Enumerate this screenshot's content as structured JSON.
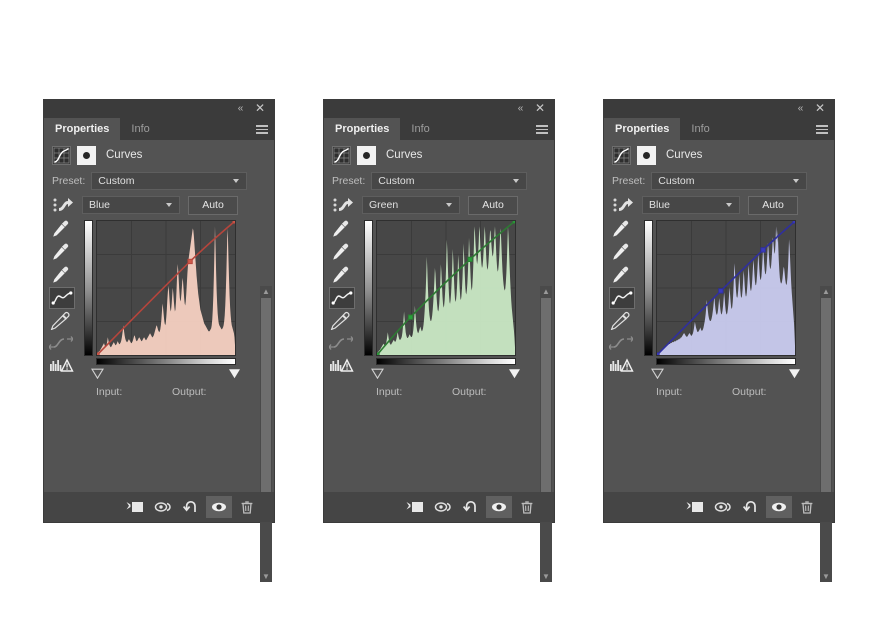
{
  "app": {
    "background_color": "#ffffff",
    "panel_bg": "#535353",
    "titlebar_bg": "#3b3b3b"
  },
  "panels": [
    {
      "id": "panel-red",
      "titlebar": {
        "collapse_icon": "double-chevron-left-icon",
        "close_icon": "close-icon"
      },
      "tabs": [
        {
          "label": "Properties",
          "active": true
        },
        {
          "label": "Info",
          "active": false
        }
      ],
      "menu_icon": "hamburger-menu-icon",
      "header": {
        "adjustment_icon": "curves-adjustment-icon",
        "mask_icon": "layer-mask-icon",
        "title": "Curves"
      },
      "preset": {
        "label": "Preset:",
        "value": "Custom"
      },
      "channel": {
        "icon": "on-image-adjust-icon",
        "value": "Blue",
        "auto_label": "Auto"
      },
      "tools": [
        "white-point-eyedropper-icon",
        "gray-point-eyedropper-icon",
        "black-point-eyedropper-icon",
        "curve-point-tool-icon",
        "pencil-tool-icon",
        "smooth-curve-icon",
        "histogram-warning-icon"
      ],
      "selected_tool": "curve-point-tool-icon",
      "labels": {
        "input": "Input:",
        "output": "Output:"
      },
      "bottom_icons": [
        "clip-to-layer-icon",
        "view-previous-state-icon",
        "reset-adjustment-icon",
        "toggle-visibility-icon",
        "delete-adjustment-icon"
      ],
      "selected_bottom_icon": "toggle-visibility-icon",
      "curve_color": "#b5453c",
      "fill_color": "rgba(252,213,198,0.92)",
      "point_color": "#cf5a4a"
    },
    {
      "id": "panel-green",
      "titlebar": {
        "collapse_icon": "double-chevron-left-icon",
        "close_icon": "close-icon"
      },
      "tabs": [
        {
          "label": "Properties",
          "active": true
        },
        {
          "label": "Info",
          "active": false
        }
      ],
      "menu_icon": "hamburger-menu-icon",
      "header": {
        "adjustment_icon": "curves-adjustment-icon",
        "mask_icon": "layer-mask-icon",
        "title": "Curves"
      },
      "preset": {
        "label": "Preset:",
        "value": "Custom"
      },
      "channel": {
        "icon": "on-image-adjust-icon",
        "value": "Green",
        "auto_label": "Auto"
      },
      "tools": [
        "white-point-eyedropper-icon",
        "gray-point-eyedropper-icon",
        "black-point-eyedropper-icon",
        "curve-point-tool-icon",
        "pencil-tool-icon",
        "smooth-curve-icon",
        "histogram-warning-icon"
      ],
      "selected_tool": "curve-point-tool-icon",
      "labels": {
        "input": "Input:",
        "output": "Output:"
      },
      "bottom_icons": [
        "clip-to-layer-icon",
        "view-previous-state-icon",
        "reset-adjustment-icon",
        "toggle-visibility-icon",
        "delete-adjustment-icon"
      ],
      "selected_bottom_icon": "toggle-visibility-icon",
      "curve_color": "#2d7a33",
      "fill_color": "rgba(206,238,201,0.92)",
      "point_color": "#28a03a"
    },
    {
      "id": "panel-blue",
      "titlebar": {
        "collapse_icon": "double-chevron-left-icon",
        "close_icon": "close-icon"
      },
      "tabs": [
        {
          "label": "Properties",
          "active": true
        },
        {
          "label": "Info",
          "active": false
        }
      ],
      "menu_icon": "hamburger-menu-icon",
      "header": {
        "adjustment_icon": "curves-adjustment-icon",
        "mask_icon": "layer-mask-icon",
        "title": "Curves"
      },
      "preset": {
        "label": "Preset:",
        "value": "Custom"
      },
      "channel": {
        "icon": "on-image-adjust-icon",
        "value": "Blue",
        "auto_label": "Auto"
      },
      "tools": [
        "white-point-eyedropper-icon",
        "gray-point-eyedropper-icon",
        "black-point-eyedropper-icon",
        "curve-point-tool-icon",
        "pencil-tool-icon",
        "smooth-curve-icon",
        "histogram-warning-icon"
      ],
      "selected_tool": "curve-point-tool-icon",
      "labels": {
        "input": "Input:",
        "output": "Output:"
      },
      "bottom_icons": [
        "clip-to-layer-icon",
        "view-previous-state-icon",
        "reset-adjustment-icon",
        "toggle-visibility-icon",
        "delete-adjustment-icon"
      ],
      "selected_bottom_icon": "toggle-visibility-icon",
      "curve_color": "#2f2f9e",
      "fill_color": "rgba(206,208,245,0.92)",
      "point_color": "#3a3ac0"
    }
  ],
  "chart_data": [
    {
      "type": "line",
      "title": "Curves — Red channel",
      "xlabel": "Input",
      "ylabel": "Output",
      "xlim": [
        0,
        255
      ],
      "ylim": [
        0,
        255
      ],
      "grid": true,
      "grid_divisions": 4,
      "curve_points": [
        {
          "input": 0,
          "output": 0
        },
        {
          "input": 172,
          "output": 178
        },
        {
          "input": 255,
          "output": 255
        }
      ],
      "histogram": [
        2,
        2,
        3,
        3,
        4,
        4,
        5,
        6,
        7,
        8,
        9,
        10,
        11,
        12,
        10,
        9,
        8,
        9,
        11,
        14,
        18,
        15,
        12,
        10,
        9,
        8,
        8,
        9,
        10,
        11,
        12,
        13,
        12,
        11,
        10,
        10,
        11,
        12,
        14,
        13,
        12,
        11,
        11,
        12,
        13,
        15,
        18,
        22,
        26,
        30,
        24,
        20,
        17,
        15,
        14,
        13,
        13,
        14,
        15,
        16,
        15,
        14,
        13,
        12,
        12,
        13,
        14,
        16,
        18,
        20,
        19,
        17,
        15,
        14,
        14,
        15,
        16,
        17,
        18,
        17,
        16,
        15,
        14,
        14,
        15,
        16,
        17,
        18,
        17,
        16,
        15,
        15,
        16,
        17,
        18,
        19,
        20,
        21,
        22,
        21,
        20,
        19,
        18,
        18,
        19,
        20,
        22,
        24,
        26,
        28,
        30,
        29,
        27,
        25,
        24,
        23,
        24,
        26,
        30,
        36,
        44,
        52,
        48,
        42,
        36,
        32,
        30,
        32,
        38,
        46,
        56,
        64,
        70,
        64,
        56,
        48,
        44,
        46,
        52,
        60,
        68,
        62,
        54,
        48,
        44,
        46,
        54,
        66,
        80,
        92,
        86,
        76,
        66,
        58,
        54,
        56,
        62,
        70,
        78,
        74,
        66,
        58,
        52,
        50,
        54,
        62,
        72,
        82,
        90,
        96,
        100,
        104,
        108,
        112,
        116,
        120,
        124,
        128,
        126,
        120,
        112,
        104,
        96,
        88,
        80,
        74,
        68,
        62,
        58,
        54,
        50,
        46,
        44,
        42,
        40,
        38,
        36,
        34,
        32,
        31,
        30,
        29,
        28,
        27,
        26,
        25,
        24,
        24,
        24,
        25,
        26,
        27,
        30,
        36,
        46,
        60,
        80,
        105,
        130,
        110,
        86,
        66,
        52,
        42,
        36,
        32,
        30,
        29,
        28,
        27,
        26,
        26,
        27,
        28,
        30,
        34,
        40,
        50,
        64,
        82,
        104,
        128,
        118,
        96,
        76,
        60,
        48,
        40,
        34,
        30,
        28,
        26,
        24,
        22,
        18,
        10
      ]
    },
    {
      "type": "line",
      "title": "Curves — Green channel",
      "xlabel": "Input",
      "ylabel": "Output",
      "xlim": [
        0,
        255
      ],
      "ylim": [
        0,
        255
      ],
      "grid": true,
      "grid_divisions": 4,
      "curve_points": [
        {
          "input": 0,
          "output": 0
        },
        {
          "input": 62,
          "output": 72
        },
        {
          "input": 172,
          "output": 182
        },
        {
          "input": 255,
          "output": 255
        }
      ],
      "histogram": [
        2,
        3,
        3,
        4,
        5,
        5,
        6,
        7,
        8,
        9,
        10,
        11,
        12,
        11,
        10,
        10,
        11,
        13,
        16,
        20,
        24,
        20,
        16,
        13,
        12,
        11,
        11,
        12,
        13,
        14,
        15,
        16,
        15,
        14,
        14,
        15,
        17,
        20,
        24,
        22,
        19,
        17,
        16,
        16,
        17,
        18,
        20,
        24,
        30,
        38,
        46,
        38,
        30,
        24,
        21,
        19,
        18,
        18,
        19,
        20,
        22,
        21,
        20,
        19,
        19,
        20,
        22,
        26,
        32,
        40,
        52,
        44,
        36,
        30,
        26,
        24,
        23,
        24,
        26,
        28,
        30,
        28,
        26,
        25,
        26,
        28,
        32,
        38,
        46,
        56,
        68,
        84,
        104,
        90,
        72,
        58,
        48,
        42,
        38,
        36,
        36,
        38,
        42,
        48,
        56,
        66,
        78,
        92,
        86,
        74,
        62,
        54,
        48,
        46,
        48,
        54,
        64,
        78,
        96,
        88,
        74,
        62,
        54,
        50,
        52,
        58,
        68,
        82,
        100,
        122,
        110,
        92,
        76,
        64,
        56,
        54,
        58,
        66,
        78,
        94,
        112,
        100,
        84,
        70,
        60,
        56,
        58,
        64,
        74,
        88,
        106,
        96,
        80,
        68,
        60,
        58,
        62,
        70,
        82,
        98,
        118,
        104,
        88,
        74,
        66,
        64,
        68,
        76,
        88,
        104,
        124,
        112,
        96,
        82,
        72,
        68,
        72,
        82,
        96,
        114,
        136,
        130,
        118,
        108,
        100,
        96,
        100,
        108,
        120,
        136,
        130,
        116,
        104,
        96,
        92,
        94,
        100,
        110,
        124,
        136,
        128,
        114,
        102,
        94,
        90,
        92,
        98,
        108,
        122,
        132,
        130,
        120,
        112,
        106,
        104,
        108,
        116,
        128,
        136,
        126,
        112,
        100,
        92,
        88,
        90,
        96,
        106,
        120,
        134,
        128,
        114,
        100,
        88,
        80,
        74,
        70,
        68,
        70,
        76,
        86,
        100,
        118,
        136,
        126,
        110,
        94,
        80,
        68,
        58,
        50,
        44,
        38,
        32,
        26,
        18,
        8
      ]
    },
    {
      "type": "line",
      "title": "Curves — Blue channel",
      "xlabel": "Input",
      "ylabel": "Output",
      "xlim": [
        0,
        255
      ],
      "ylim": [
        0,
        255
      ],
      "grid": true,
      "grid_divisions": 4,
      "curve_points": [
        {
          "input": 0,
          "output": 0
        },
        {
          "input": 118,
          "output": 122
        },
        {
          "input": 196,
          "output": 200
        },
        {
          "input": 255,
          "output": 255
        }
      ],
      "histogram": [
        1,
        1,
        2,
        2,
        3,
        3,
        4,
        4,
        5,
        5,
        6,
        6,
        7,
        7,
        8,
        8,
        9,
        9,
        10,
        10,
        11,
        11,
        12,
        12,
        12,
        13,
        13,
        13,
        14,
        14,
        14,
        14,
        15,
        15,
        15,
        15,
        16,
        16,
        16,
        17,
        17,
        17,
        18,
        18,
        19,
        19,
        20,
        21,
        22,
        23,
        24,
        23,
        22,
        21,
        20,
        20,
        20,
        21,
        22,
        23,
        24,
        23,
        22,
        21,
        21,
        22,
        23,
        25,
        28,
        32,
        36,
        33,
        30,
        28,
        26,
        25,
        25,
        26,
        27,
        28,
        30,
        28,
        27,
        26,
        27,
        28,
        30,
        33,
        36,
        40,
        45,
        52,
        60,
        54,
        48,
        43,
        40,
        38,
        37,
        37,
        38,
        40,
        43,
        47,
        52,
        58,
        64,
        56,
        50,
        46,
        44,
        44,
        46,
        50,
        56,
        62,
        56,
        50,
        46,
        44,
        45,
        48,
        53,
        60,
        68,
        62,
        54,
        48,
        45,
        44,
        46,
        50,
        56,
        64,
        74,
        66,
        58,
        52,
        50,
        52,
        58,
        68,
        82,
        100,
        92,
        80,
        70,
        64,
        62,
        64,
        70,
        78,
        88,
        80,
        70,
        64,
        62,
        64,
        70,
        80,
        92,
        86,
        76,
        68,
        64,
        64,
        68,
        76,
        86,
        98,
        92,
        82,
        74,
        70,
        70,
        74,
        82,
        92,
        104,
        98,
        88,
        80,
        76,
        76,
        80,
        88,
        98,
        110,
        104,
        94,
        86,
        82,
        82,
        86,
        94,
        104,
        116,
        110,
        100,
        92,
        88,
        88,
        92,
        100,
        110,
        122,
        116,
        106,
        98,
        94,
        94,
        98,
        106,
        116,
        128,
        124,
        116,
        110,
        112,
        122,
        140,
        132,
        122,
        136,
        120,
        104,
        92,
        84,
        80,
        78,
        78,
        80,
        84,
        90,
        96,
        94,
        88,
        82,
        78,
        76,
        78,
        84,
        94,
        108,
        126,
        118,
        104,
        90,
        78,
        68,
        60,
        52,
        44,
        36,
        24,
        10
      ]
    }
  ]
}
